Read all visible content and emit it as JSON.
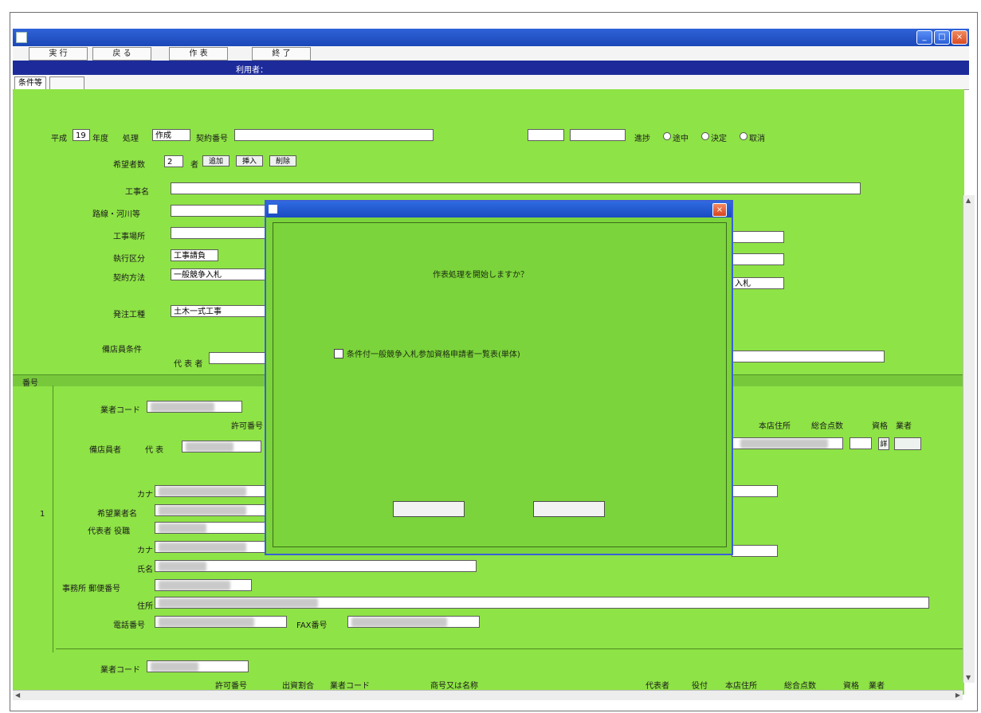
{
  "window": {
    "title": "",
    "controls": [
      "minimize",
      "maximize",
      "close"
    ]
  },
  "menu": [
    {
      "label": "実 行"
    },
    {
      "label": "戻 る"
    },
    {
      "label": "作 表"
    },
    {
      "label": "終 了"
    }
  ],
  "userbar": {
    "screen_name": "",
    "user_label": "利用者：",
    "user_value": "",
    "right_code": ""
  },
  "tabs": [
    {
      "label": "条件等"
    },
    {
      "label": ""
    }
  ],
  "form": {
    "heisei_label": "平成",
    "year_value": "19",
    "nendo_label": "年度",
    "status_label": "処理",
    "status_value": "作成",
    "contract_no_label": "契約番号",
    "contract_office": "",
    "code1": "",
    "code2": "",
    "progress_label": "進捗",
    "radio_options": [
      "途中",
      "決定",
      "取消"
    ],
    "applicants_label": "希望者数",
    "applicants_value": "2",
    "applicants_unit": "者",
    "add_button": "追加",
    "insert_button": "挿入",
    "delete_button": "削除",
    "project_name_label": "工事名",
    "road_river_label": "路線・河川等",
    "location_label": "工事場所",
    "location_value": "",
    "category_label": "執行区分",
    "category_value": "工事請負",
    "method_label": "契約方法",
    "method_value": "一般競争入札",
    "method_right": "入札",
    "type_label": "発注工種",
    "type_value": "土木一式工事",
    "conditions_label": "備店員条件",
    "rep_label": "代 表 者",
    "rep_code": "",
    "grade_header": "",
    "grade_value": ""
  },
  "section": {
    "label": "番号",
    "row_number": "1",
    "company_code_label": "業者コード",
    "permit_no_header": "許可番号",
    "right_headers": [
      "本店住所",
      "総合点数",
      "資格",
      "業者"
    ],
    "applicant_label": "備店員者",
    "rep_prefix": "代 表",
    "kana_label": "カナ",
    "applicant_name_label": "希望業者名",
    "representative_title_label": "代表者 役職",
    "kana2_label": "カナ",
    "name_label": "氏名",
    "office_postal_label": "事務所 郵便番号",
    "address_label": "住所",
    "phone_label": "電話番号",
    "fax_label": "FAX番号",
    "company_code2_label": "業者コード",
    "bottom_headers": [
      "許可番号",
      "出資割合",
      "業者コード",
      "商号又は名称",
      "代表者",
      "役付",
      "本店住所",
      "総合点数",
      "資格",
      "業者"
    ],
    "detail_button": "詳"
  },
  "dialog": {
    "title": "",
    "question": "作表処理を開始しますか？",
    "checkbox_label": "条件付一般競争入札参加資格申請者一覧表(単体)",
    "ok_button": "",
    "cancel_button": ""
  }
}
